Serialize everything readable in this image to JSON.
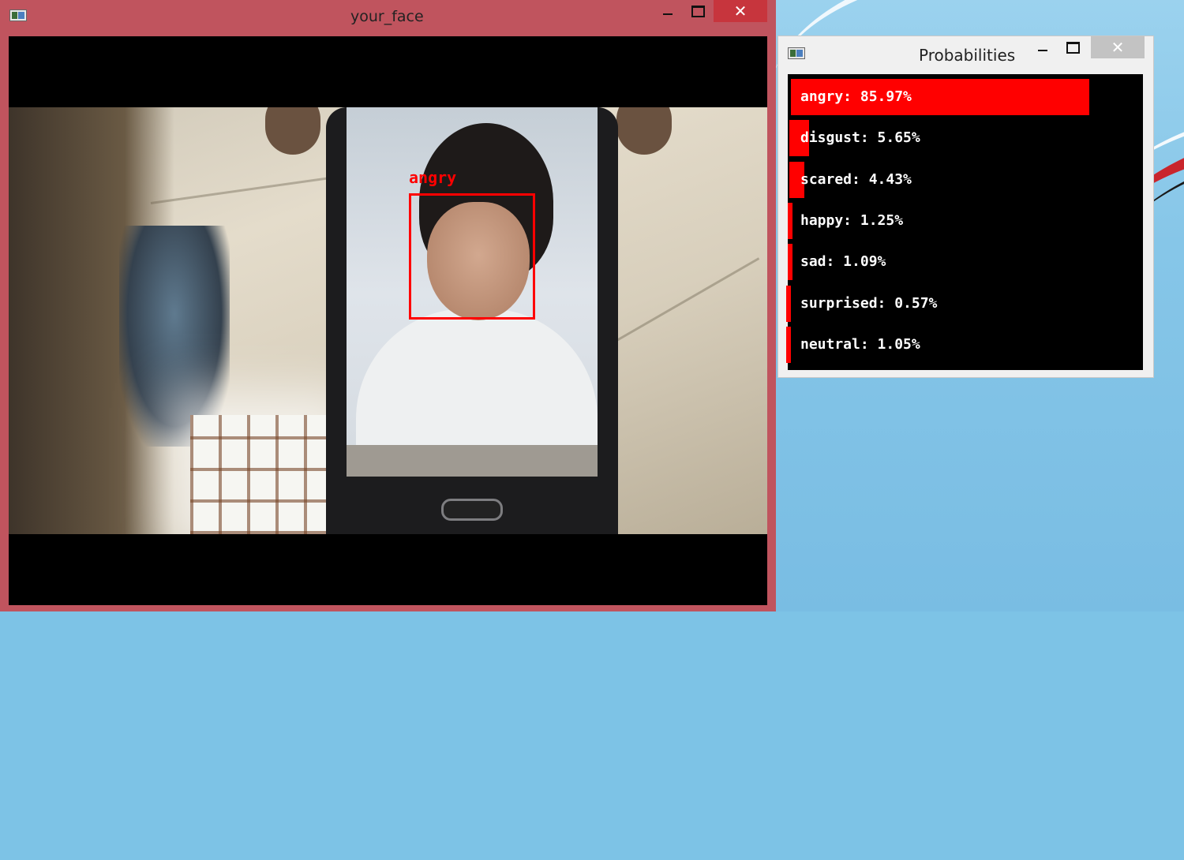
{
  "main_window": {
    "title": "your_face",
    "controls": {
      "minimize": "—",
      "maximize": "",
      "close": "✕"
    },
    "detection_label": "angry"
  },
  "prob_window": {
    "title": "Probabilities",
    "controls": {
      "minimize": "—",
      "maximize": "",
      "close": "✕"
    }
  },
  "probabilities": [
    {
      "label": "angry: 85.97%",
      "value": 85.97
    },
    {
      "label": "disgust: 5.65%",
      "value": 5.65
    },
    {
      "label": "scared: 4.43%",
      "value": 4.43
    },
    {
      "label": "happy: 1.25%",
      "value": 1.25
    },
    {
      "label": "sad: 1.09%",
      "value": 1.09
    },
    {
      "label": "surprised: 0.57%",
      "value": 0.57
    },
    {
      "label": "neutral: 1.05%",
      "value": 1.05
    }
  ],
  "colors": {
    "main_frame": "#c0545e",
    "bar": "#ff0000",
    "close_active": "#c7353d"
  },
  "icons": [
    "app-icon",
    "minimize-icon",
    "maximize-icon",
    "close-icon"
  ]
}
